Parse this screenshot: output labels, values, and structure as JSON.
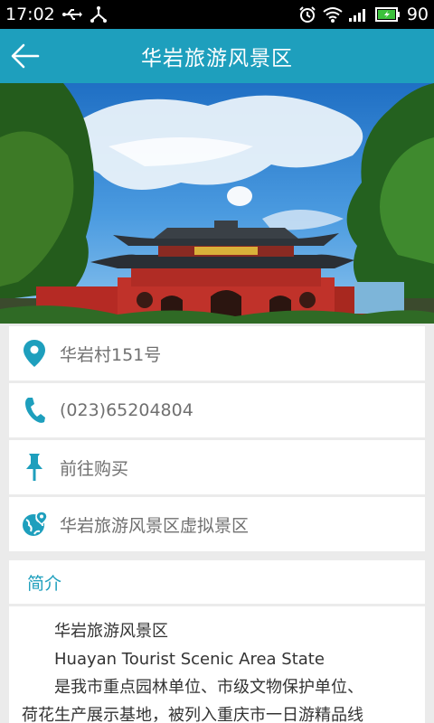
{
  "status_bar": {
    "time": "17:02",
    "battery": "90"
  },
  "header": {
    "title": "华岩旅游风景区"
  },
  "info_rows": [
    {
      "icon": "location-pin-icon",
      "label": "华岩村151号"
    },
    {
      "icon": "phone-icon",
      "label": "(023)65204804"
    },
    {
      "icon": "pushpin-icon",
      "label": "前往购买"
    },
    {
      "icon": "globe-pin-icon",
      "label": "华岩旅游风景区虚拟景区"
    }
  ],
  "intro": {
    "heading": "简介",
    "lines": [
      "华岩旅游风景区",
      "Huayan Tourist Scenic Area State",
      "是我市重点园林单位、市级文物保护单位、",
      "荷花生产展示基地，被列入重庆市一日游精品线"
    ]
  },
  "colors": {
    "accent": "#1e9fbd",
    "background": "#ebebeb"
  }
}
